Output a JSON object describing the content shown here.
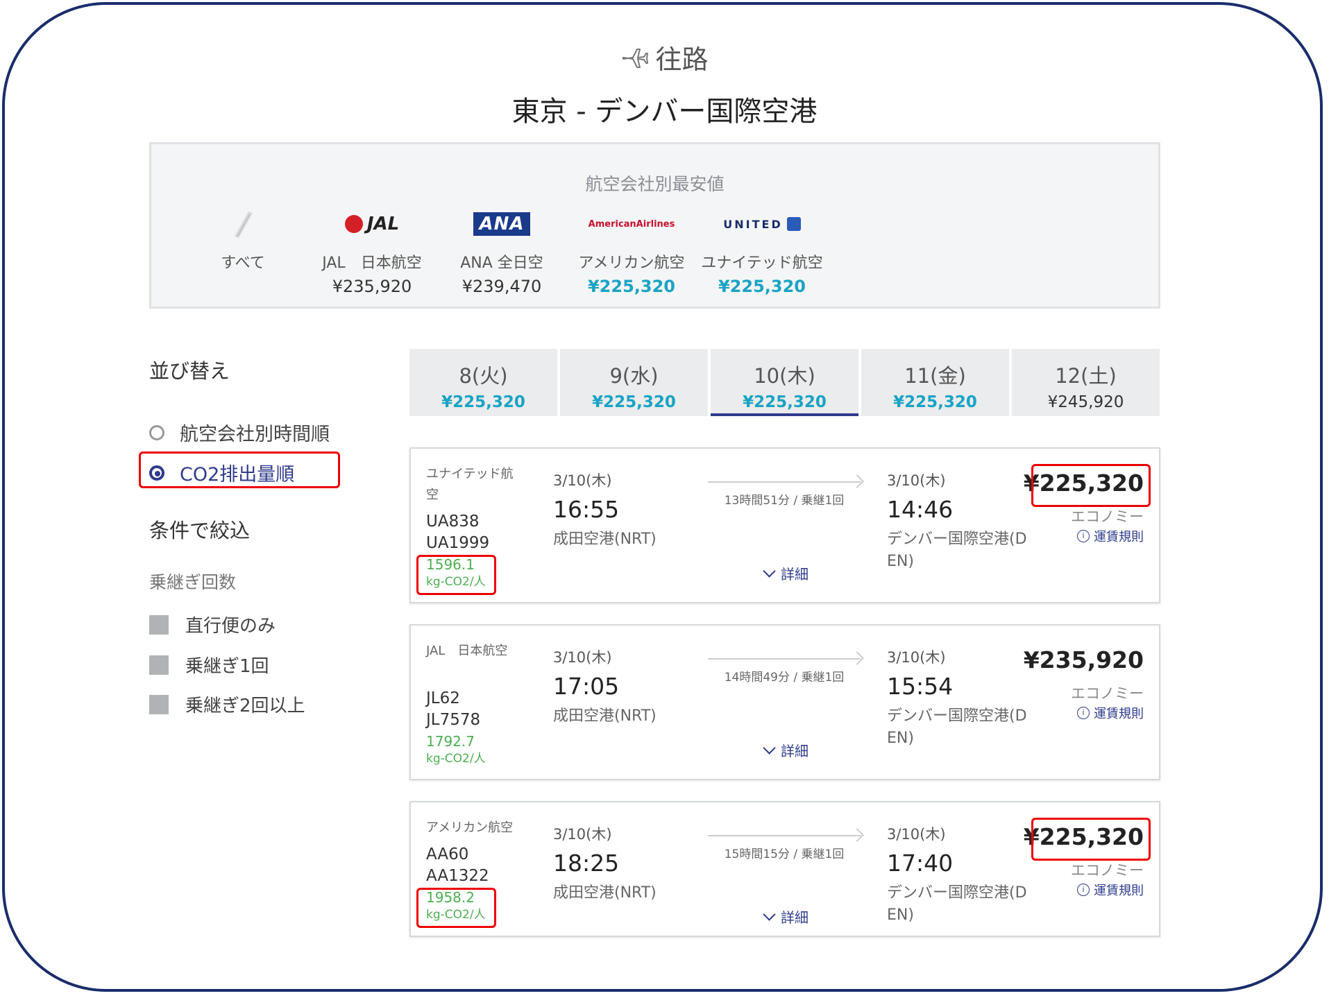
{
  "header": {
    "direction": "往路",
    "route": "東京 - デンバー国際空港"
  },
  "airline_box": {
    "title": "航空会社別最安値",
    "items": [
      {
        "name": "すべて",
        "price": "",
        "icon": "all-airlines-icon"
      },
      {
        "name": "JAL　日本航空",
        "price": "¥235,920",
        "logo": "JAL"
      },
      {
        "name": "ANA 全日空",
        "price": "¥239,470",
        "logo": "ANA"
      },
      {
        "name": "アメリカン航空",
        "price": "¥225,320",
        "logo": "AmericanAirlines"
      },
      {
        "name": "ユナイテッド航空",
        "price": "¥225,320",
        "logo": "UNITED"
      }
    ]
  },
  "sort": {
    "title": "並び替え",
    "options": [
      "航空会社別時間順",
      "CO2排出量順"
    ],
    "selected": "CO2排出量順"
  },
  "filter": {
    "title": "条件で絞込",
    "subtitle": "乗継ぎ回数",
    "options": [
      "直行便のみ",
      "乗継ぎ1回",
      "乗継ぎ2回以上"
    ]
  },
  "date_tabs": [
    {
      "day": "8(火)",
      "price": "¥225,320"
    },
    {
      "day": "9(水)",
      "price": "¥225,320"
    },
    {
      "day": "10(木)",
      "price": "¥225,320"
    },
    {
      "day": "11(金)",
      "price": "¥225,320"
    },
    {
      "day": "12(土)",
      "price": "¥245,920"
    }
  ],
  "selected_tab": "10(木)",
  "flights": [
    {
      "airline": "ユナイテッド航空",
      "flight1": "UA838",
      "flight2": "UA1999",
      "co2_value": "1596.1",
      "co2_unit": "kg-CO2/人",
      "dep_date": "3/10(木)",
      "dep_time": "16:55",
      "dep_airport": "成田空港(NRT)",
      "duration": "13時間51分 / 乗継1回",
      "arr_date": "3/10(木)",
      "arr_time": "14:46",
      "arr_airport": "デンバー国際空港(DEN)",
      "detail": "詳細",
      "price": "¥225,320",
      "class": "エコノミー",
      "rule": "運賃規則"
    },
    {
      "airline": "JAL　日本航空",
      "flight1": "JL62",
      "flight2": "JL7578",
      "co2_value": "1792.7",
      "co2_unit": "kg-CO2/人",
      "dep_date": "3/10(木)",
      "dep_time": "17:05",
      "dep_airport": "成田空港(NRT)",
      "duration": "14時間49分 / 乗継1回",
      "arr_date": "3/10(木)",
      "arr_time": "15:54",
      "arr_airport": "デンバー国際空港(DEN)",
      "detail": "詳細",
      "price": "¥235,920",
      "class": "エコノミー",
      "rule": "運賃規則"
    },
    {
      "airline": "アメリカン航空",
      "flight1": "AA60",
      "flight2": "AA1322",
      "co2_value": "1958.2",
      "co2_unit": "kg-CO2/人",
      "dep_date": "3/10(木)",
      "dep_time": "18:25",
      "dep_airport": "成田空港(NRT)",
      "duration": "15時間15分 / 乗継1回",
      "arr_date": "3/10(木)",
      "arr_time": "17:40",
      "arr_airport": "デンバー国際空港(DEN)",
      "detail": "詳細",
      "price": "¥225,320",
      "class": "エコノミー",
      "rule": "運賃規則"
    }
  ],
  "colors": {
    "accent": "#2f3b8c",
    "cheap_price": "#1aa3c4",
    "co2": "#4caf50",
    "highlight_box": "#e00000",
    "frame": "#1a2d6b"
  }
}
